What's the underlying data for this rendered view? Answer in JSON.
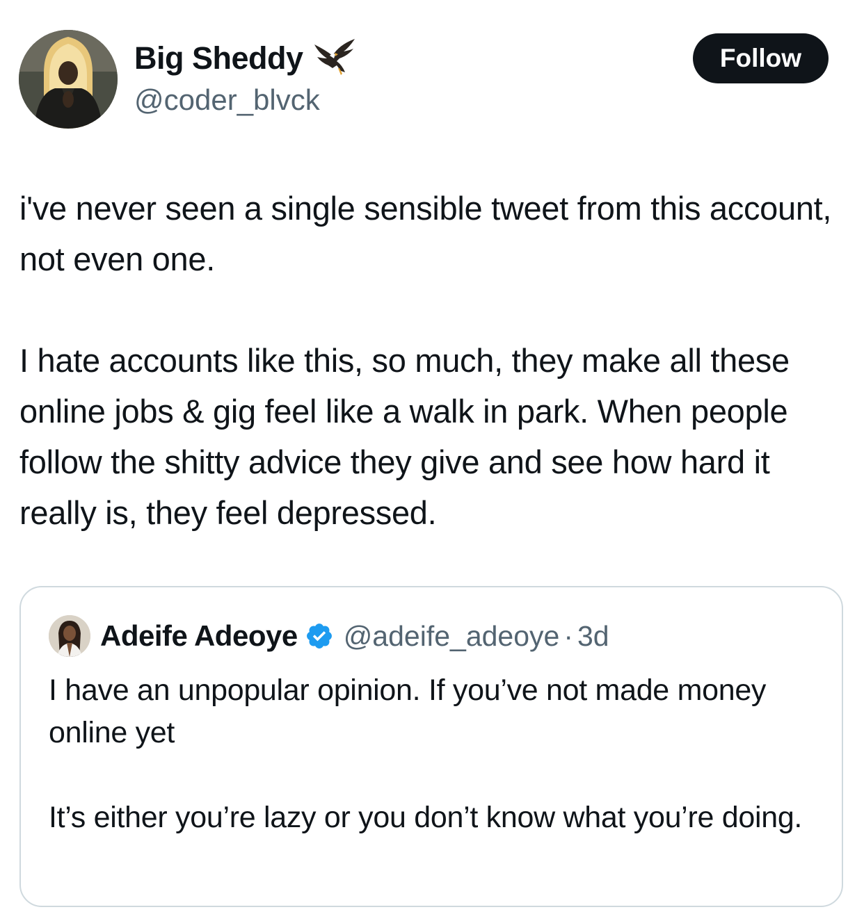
{
  "author": {
    "display_name": "Big Sheddy",
    "handle": "@coder_blvck",
    "badge_icon": "eagle-icon"
  },
  "follow_button": {
    "label": "Follow"
  },
  "tweet": {
    "paragraphs": [
      "i've never seen a single sensible tweet from this account, not even one.",
      "I hate accounts like this, so much, they make all these online jobs & gig feel like a walk in park. When people follow the shitty advice they give and see how hard it really is, they feel depressed."
    ]
  },
  "quoted_tweet": {
    "display_name": "Adeife Adeoye",
    "verified_icon": "verified-badge-icon",
    "handle": "@adeife_adeoye",
    "separator": "·",
    "time": "3d",
    "paragraphs": [
      "I have an unpopular opinion. If you’ve not made money online yet",
      "It’s either you’re lazy or you don’t know what you’re doing."
    ]
  },
  "colors": {
    "text_primary": "#0f1419",
    "text_secondary": "#536471",
    "button_bg": "#0f1419",
    "button_text": "#ffffff",
    "card_border": "#cfd9de",
    "verified_blue": "#1d9bf0"
  }
}
